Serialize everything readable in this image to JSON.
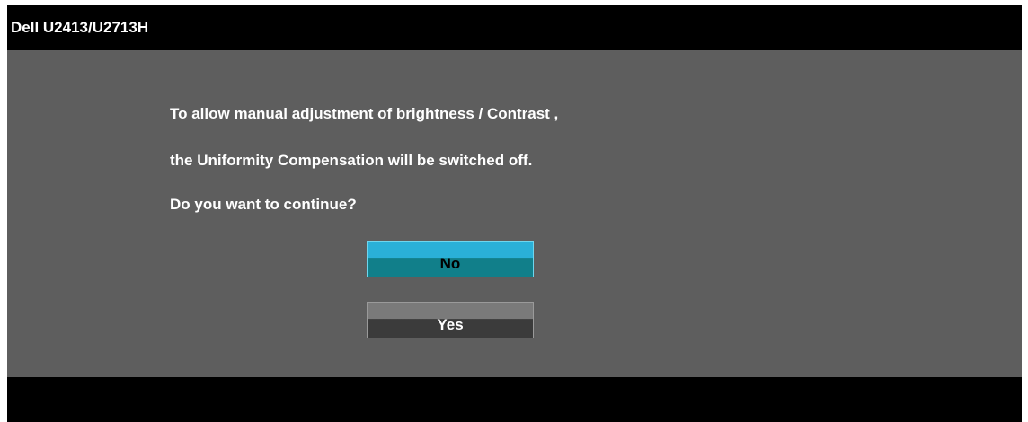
{
  "window": {
    "title": "Dell U2413/U2713H"
  },
  "dialog": {
    "lines": [
      "To allow manual adjustment of brightness / Contrast ,",
      "the Uniformity Compensation  will be switched off.",
      "Do you want to continue?"
    ],
    "buttons": {
      "no_label": "No",
      "yes_label": "Yes"
    }
  },
  "colors": {
    "panel_background": "#5e5e5e",
    "bar_background": "#000000",
    "selected_button": "#1ba3c6",
    "unselected_button": "#4a4a4a"
  }
}
